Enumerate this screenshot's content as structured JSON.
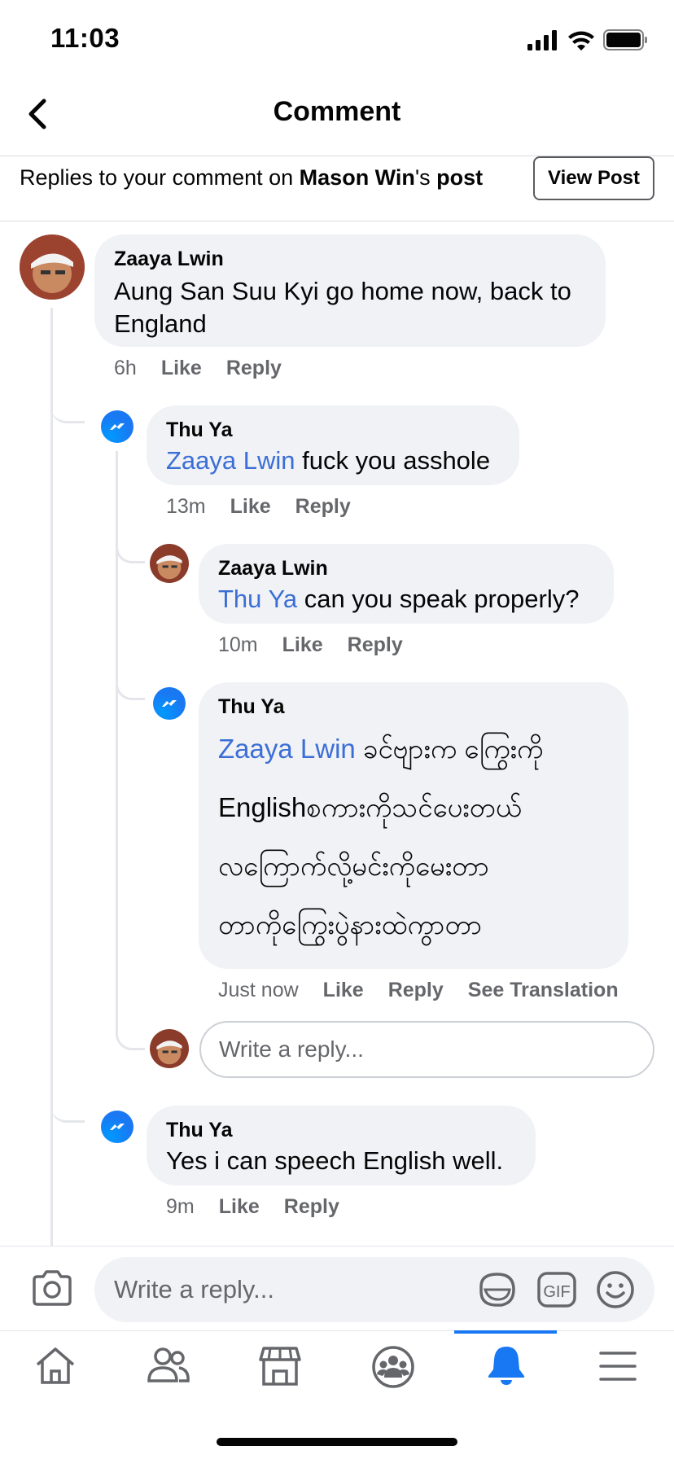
{
  "status_bar": {
    "time": "11:03"
  },
  "header": {
    "title": "Comment"
  },
  "context": {
    "prefix": "Replies to your comment on ",
    "owner": "Mason Win",
    "suffix_plain": "'s ",
    "suffix_bold": "post",
    "view_post_label": "View Post"
  },
  "comments": [
    {
      "author": "Zaaya Lwin",
      "mention": "",
      "text_line1": "Aung San Suu Kyi go home now, back to",
      "text_line2": "England",
      "time": "6h",
      "like": "Like",
      "reply": "Reply"
    },
    {
      "author": "Thu Ya",
      "mention": "Zaaya Lwin",
      "text": " fuck you asshole",
      "time": "13m",
      "like": "Like",
      "reply": "Reply"
    },
    {
      "author": "Zaaya Lwin",
      "mention": "Thu Ya",
      "text": " can you speak properly?",
      "time": "10m",
      "like": "Like",
      "reply": "Reply"
    },
    {
      "author": "Thu Ya",
      "mention": "Zaaya Lwin",
      "lines": [
        " ခင်ဗျားက ကြွေးကို",
        "Englishစကားကိုသင်ပေးတယ်",
        "လကြောက်လို့မင်းကိုမေးတာ",
        "တာကိုကြွေးပွဲနားထဲကွာတာ"
      ],
      "time": "Just now",
      "like": "Like",
      "reply": "Reply",
      "translate": "See Translation"
    },
    {
      "author": "Thu Ya",
      "mention": "",
      "text": "Yes i can speech English well.",
      "time": "9m",
      "like": "Like",
      "reply": "Reply"
    }
  ],
  "inline_reply": {
    "placeholder": "Write a reply..."
  },
  "composer": {
    "placeholder": "Write a reply..."
  },
  "tabs": [
    {
      "name": "home",
      "icon": "home-icon"
    },
    {
      "name": "friends",
      "icon": "friends-icon"
    },
    {
      "name": "marketplace",
      "icon": "marketplace-icon"
    },
    {
      "name": "groups",
      "icon": "groups-icon"
    },
    {
      "name": "notifications",
      "icon": "bell-icon",
      "active": true
    },
    {
      "name": "menu",
      "icon": "menu-icon"
    }
  ],
  "colors": {
    "accent": "#1877f2",
    "mention": "#3b6ed6",
    "bubble": "#f0f2f5",
    "meta": "#65676b"
  }
}
